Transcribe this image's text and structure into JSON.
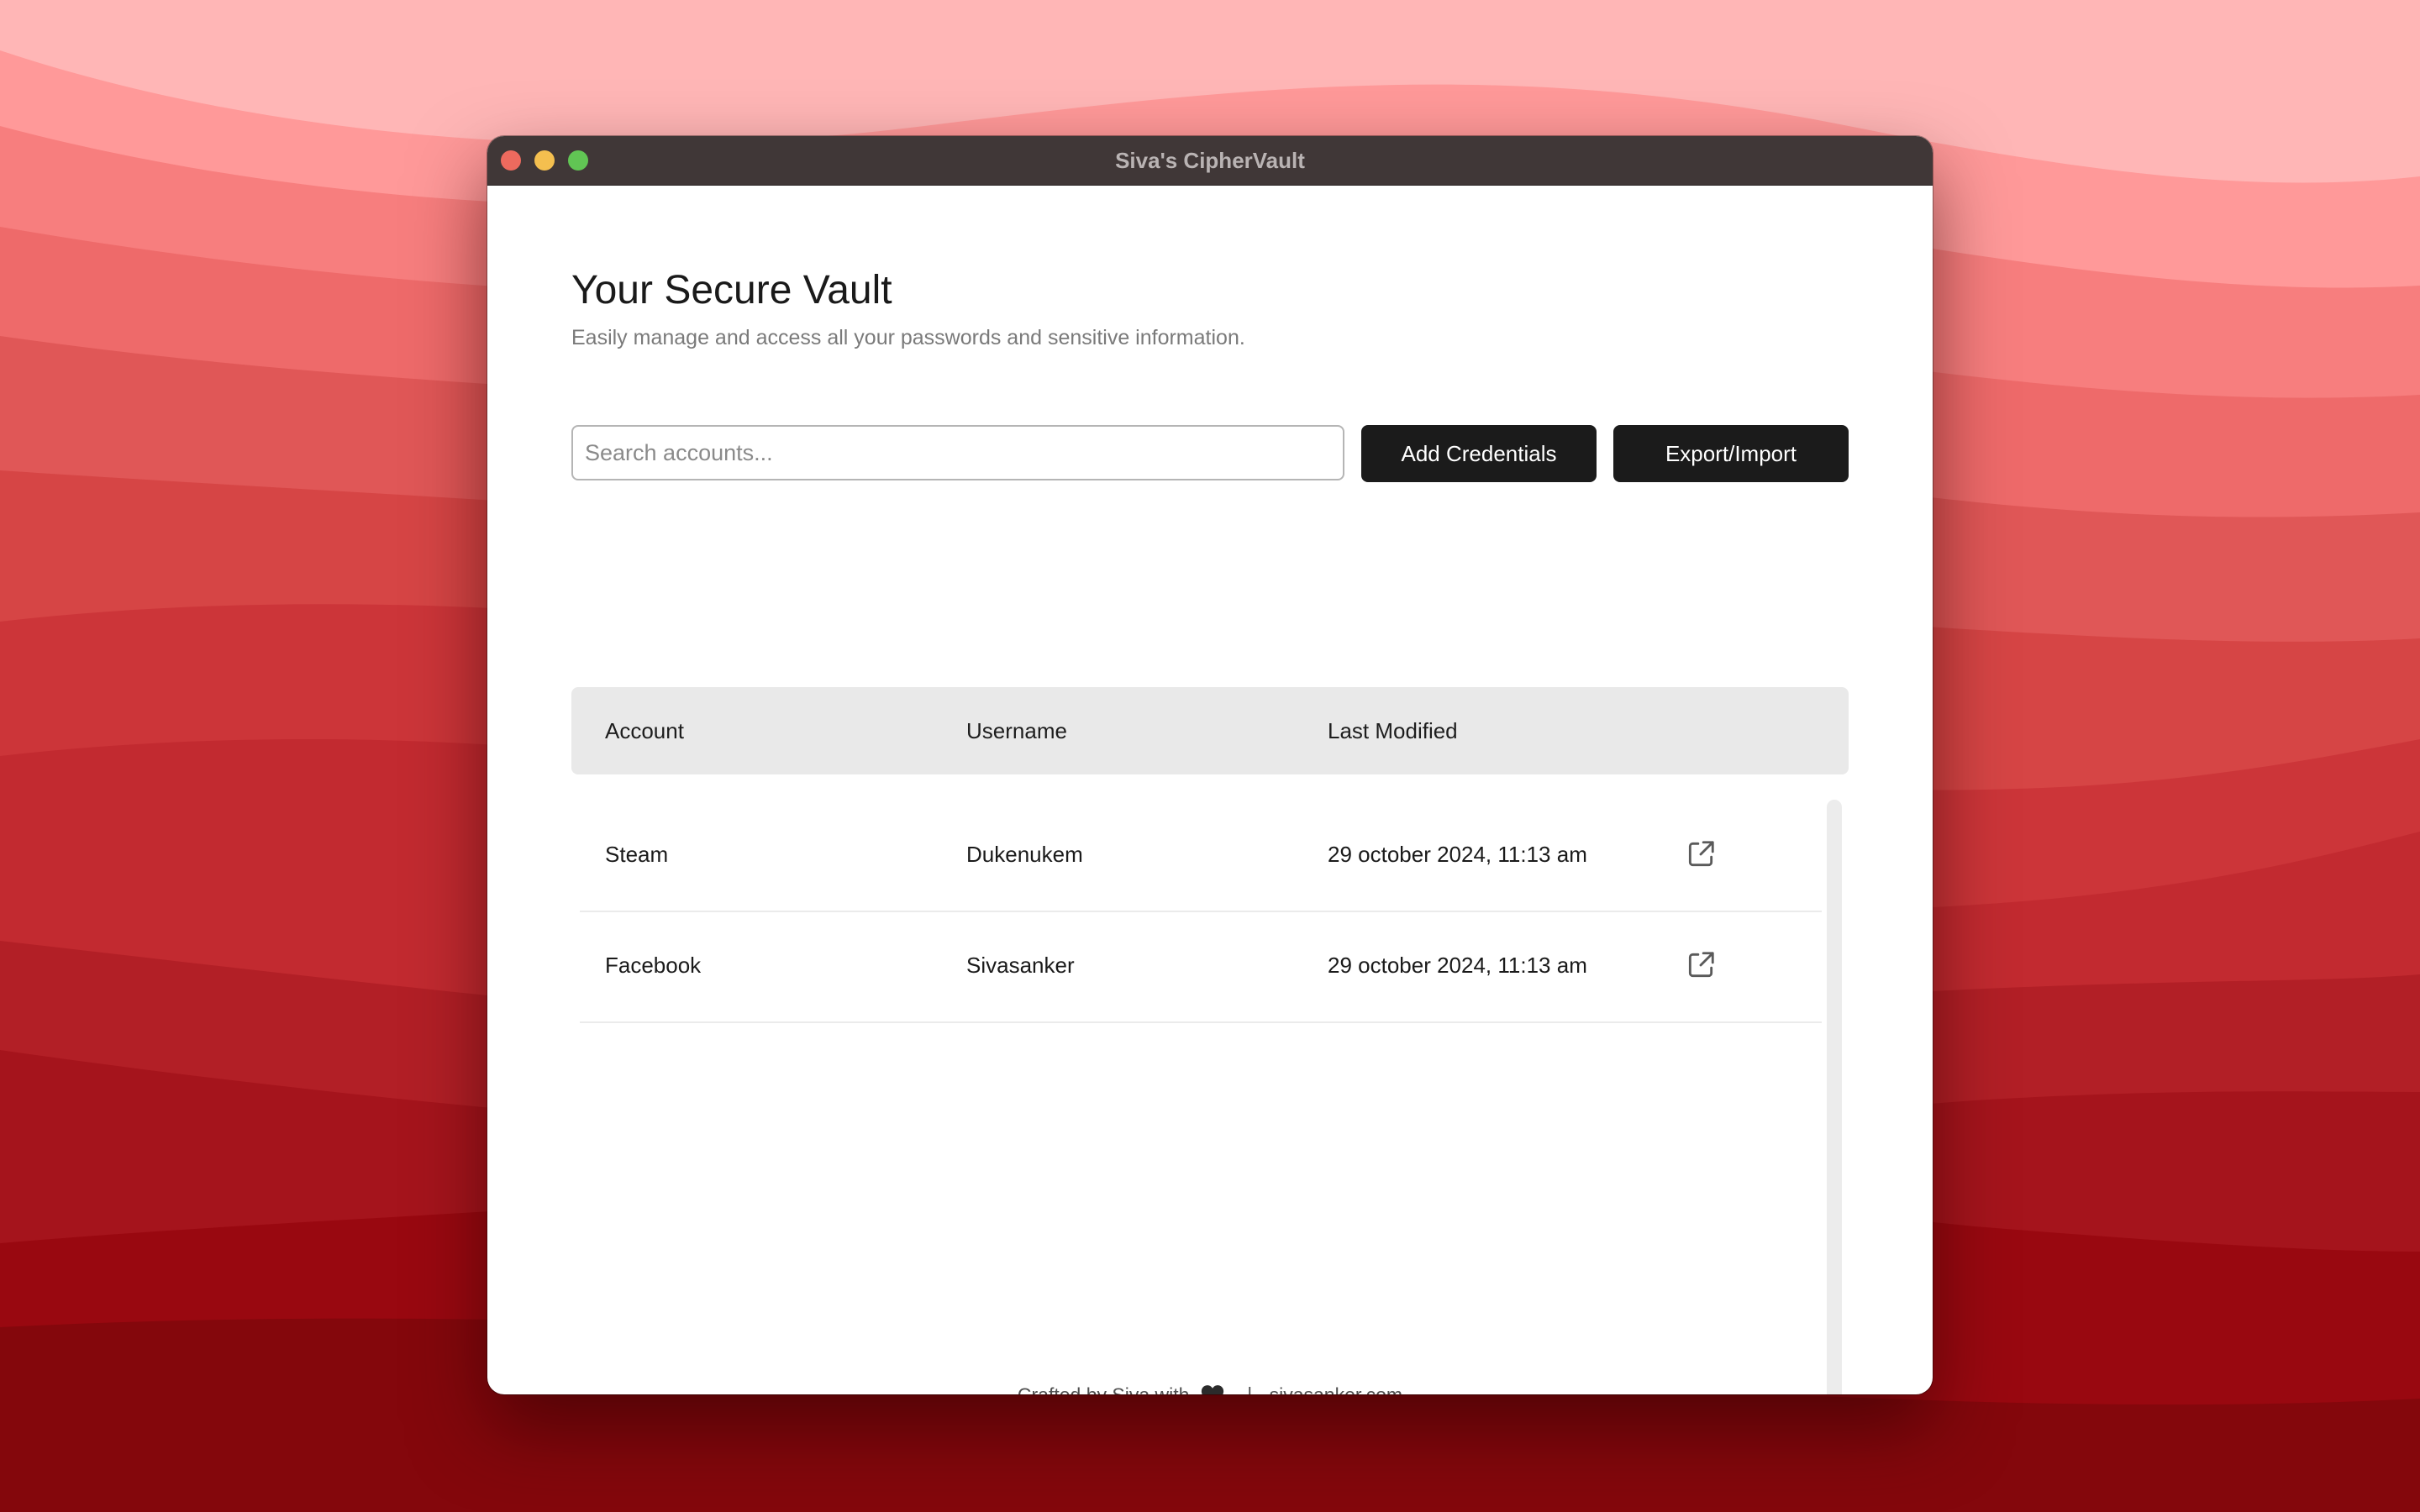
{
  "window": {
    "title": "Siva's CipherVault"
  },
  "vault": {
    "heading": "Your Secure Vault",
    "subheading": "Easily manage and access all your passwords and sensitive information."
  },
  "toolbar": {
    "search_placeholder": "Search accounts...",
    "search_value": "",
    "add_label": "Add Credentials",
    "export_label": "Export/Import"
  },
  "table": {
    "headers": {
      "account": "Account",
      "username": "Username",
      "last_modified": "Last Modified"
    },
    "rows": [
      {
        "account": "Steam",
        "username": "Dukenukem",
        "last_modified": "29 october 2024, 11:13 am",
        "action_icon": "open-external-icon"
      },
      {
        "account": "Facebook",
        "username": "Sivasanker",
        "last_modified": "29 october 2024, 11:13 am",
        "action_icon": "open-external-icon"
      }
    ]
  },
  "footer": {
    "crafted": "Crafted by Siva with",
    "heart_icon": "black-heart-icon",
    "separator": "|",
    "link": "sivasanker.com"
  },
  "colors": {
    "titlebar": "#403737",
    "button": "#1b1b1b",
    "table_header": "#e9e9e9",
    "wallpaper_light": "#ffb4b4",
    "wallpaper_dark": "#7a0a0c"
  }
}
